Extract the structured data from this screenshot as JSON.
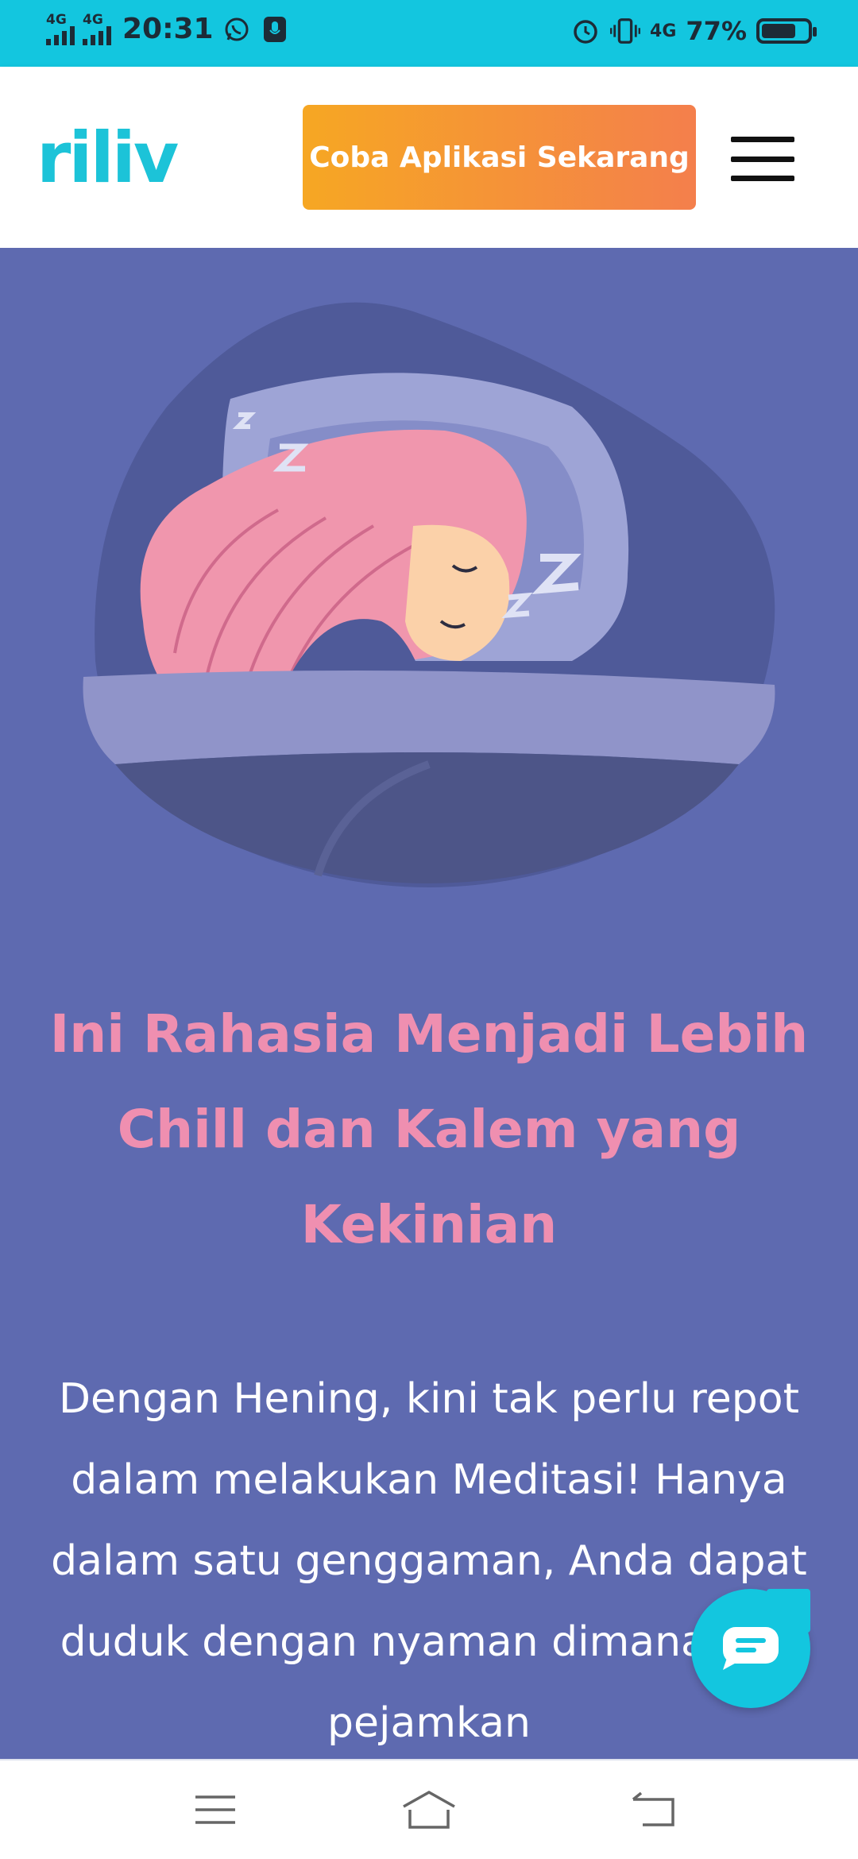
{
  "status_bar": {
    "network_1": "4G",
    "network_2": "4G",
    "time": "20:31",
    "data_network": "4G",
    "battery_percent": "77%",
    "battery_level": 0.77,
    "icons": [
      "whatsapp-icon",
      "recorder-icon",
      "alarm-icon",
      "vibrate-icon",
      "battery-icon"
    ]
  },
  "header": {
    "logo": "riliv",
    "cta_label": "Coba Aplikasi Sekarang",
    "menu_icon": "hamburger-menu-icon"
  },
  "hero": {
    "illustration": "sleeping-woman-illustration",
    "title": "Ini Rahasia Menjadi Lebih Chill dan Kalem yang Kekinian",
    "body": "Dengan Hening, kini tak perlu repot dalam melakukan Meditasi! Hanya dalam satu genggaman, Anda dapat duduk dengan nyaman dimanapun, pejamkan"
  },
  "chat_button": {
    "icon": "chat-bubble-icon"
  },
  "nav_bar": {
    "icons": [
      "menu-icon",
      "home-icon",
      "back-icon"
    ]
  },
  "colors": {
    "status_bar": "#13c6df",
    "brand": "#1cc3d8",
    "cta_start": "#f6a723",
    "cta_end": "#f47f4c",
    "hero_bg": "#5e6ab0",
    "title": "#ef8fb0"
  }
}
